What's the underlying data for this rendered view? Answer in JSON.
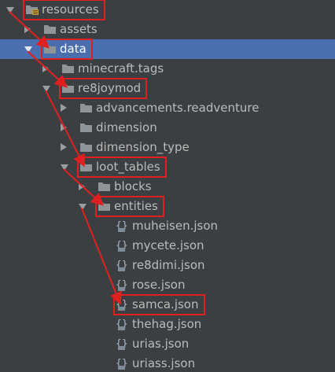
{
  "tree": {
    "items": [
      {
        "label": "resources",
        "icon": "resources-folder-icon",
        "expander": "expanded",
        "level": 0
      },
      {
        "label": "assets",
        "icon": "folder-icon",
        "expander": "collapsed",
        "level": 1
      },
      {
        "label": "data",
        "icon": "folder-icon",
        "expander": "expanded",
        "level": 1,
        "selected": true
      },
      {
        "label": "minecraft.tags",
        "icon": "folder-icon",
        "expander": "collapsed",
        "level": 2
      },
      {
        "label": "re8joymod",
        "icon": "folder-icon",
        "expander": "expanded",
        "level": 2
      },
      {
        "label": "advancements.readventure",
        "icon": "folder-icon",
        "expander": "collapsed",
        "level": 3
      },
      {
        "label": "dimension",
        "icon": "folder-icon",
        "expander": "collapsed",
        "level": 3
      },
      {
        "label": "dimension_type",
        "icon": "folder-icon",
        "expander": "collapsed",
        "level": 3
      },
      {
        "label": "loot_tables",
        "icon": "folder-icon",
        "expander": "expanded",
        "level": 3
      },
      {
        "label": "blocks",
        "icon": "folder-icon",
        "expander": "collapsed",
        "level": 4
      },
      {
        "label": "entities",
        "icon": "folder-icon",
        "expander": "expanded",
        "level": 4
      },
      {
        "label": "muheisen.json",
        "icon": "json-file-icon",
        "expander": "none",
        "level": 5
      },
      {
        "label": "mycete.json",
        "icon": "json-file-icon",
        "expander": "none",
        "level": 5
      },
      {
        "label": "re8dimi.json",
        "icon": "json-file-icon",
        "expander": "none",
        "level": 5
      },
      {
        "label": "rose.json",
        "icon": "json-file-icon",
        "expander": "none",
        "level": 5
      },
      {
        "label": "samca.json",
        "icon": "json-file-icon",
        "expander": "none",
        "level": 5
      },
      {
        "label": "thehag.json",
        "icon": "json-file-icon",
        "expander": "none",
        "level": 5
      },
      {
        "label": "urias.json",
        "icon": "json-file-icon",
        "expander": "none",
        "level": 5
      },
      {
        "label": "uriass.json",
        "icon": "json-file-icon",
        "expander": "none",
        "level": 5
      }
    ]
  },
  "colors": {
    "background": "#3c3f41",
    "selection": "#4b6eaf",
    "text": "#bbbbbb",
    "folder": "#8f9499",
    "annotation": "#e02020"
  },
  "annotations": {
    "highlighted_items": [
      "resources",
      "data",
      "re8joymod",
      "loot_tables",
      "entities",
      "samca.json"
    ]
  }
}
